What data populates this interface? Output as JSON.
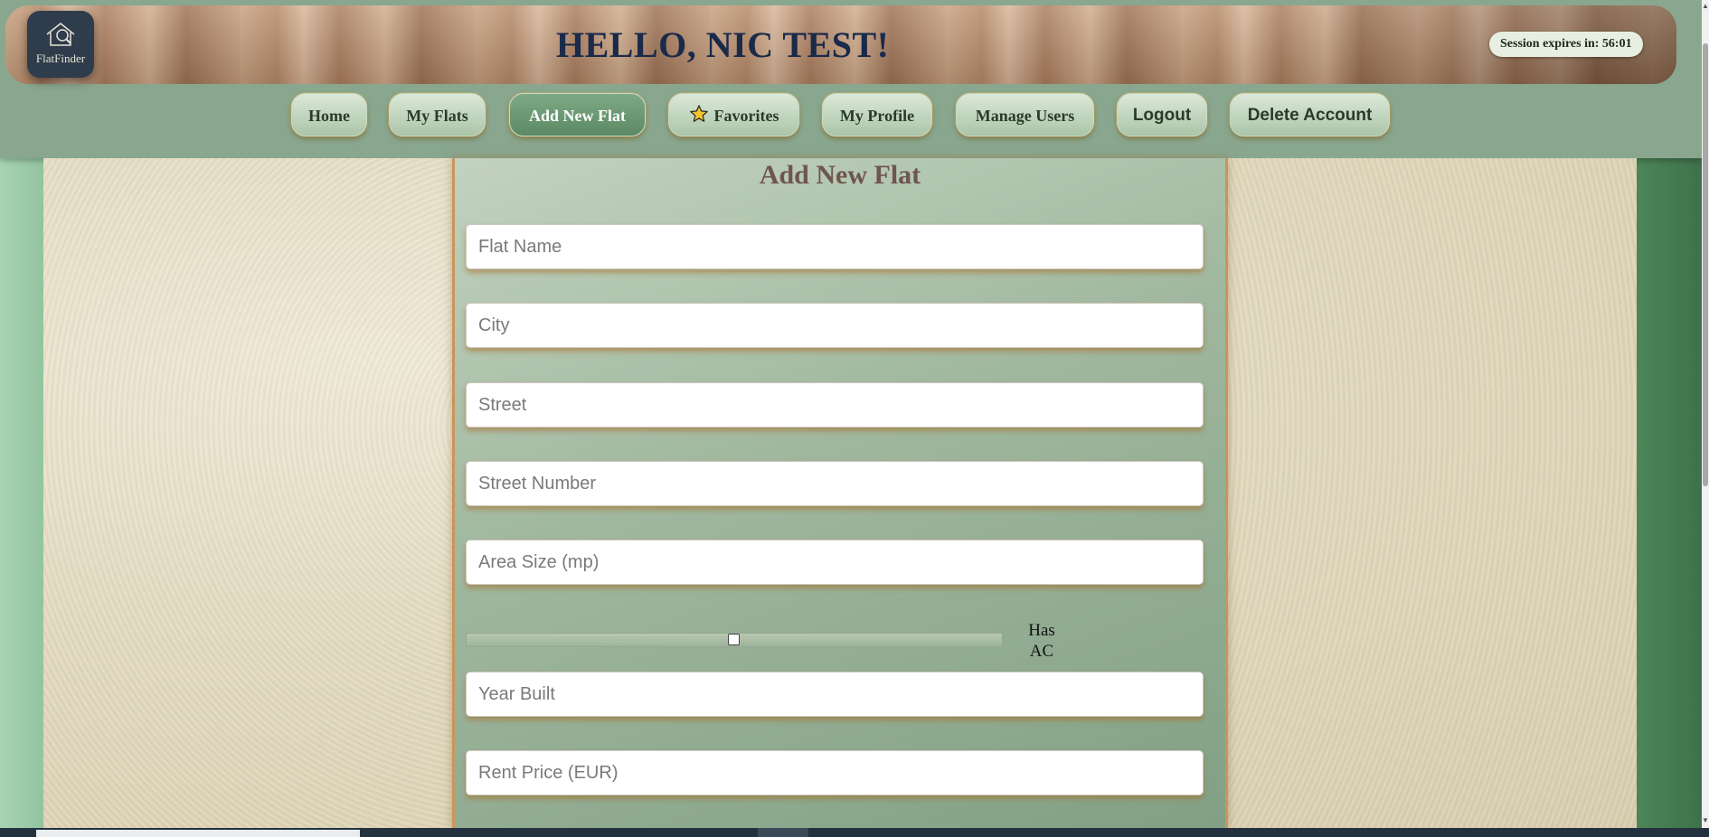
{
  "header": {
    "logo_text": "FlatFinder",
    "greeting": "HELLO, NIC TEST!",
    "session": "Session expires in: 56:01"
  },
  "nav": {
    "home": "Home",
    "my_flats": "My Flats",
    "add_new_flat": "Add New Flat",
    "favorites": "Favorites",
    "my_profile": "My Profile",
    "manage_users": "Manage Users",
    "logout": "Logout",
    "delete_account": "Delete Account",
    "active": "Add New Flat"
  },
  "form": {
    "title": "Add New Flat",
    "flat_name_placeholder": "Flat Name",
    "city_placeholder": "City",
    "street_placeholder": "Street",
    "street_number_placeholder": "Street Number",
    "area_size_placeholder": "Area Size (mp)",
    "has_ac_label": "Has AC",
    "has_ac_checked": false,
    "year_built_placeholder": "Year Built",
    "rent_price_placeholder": "Rent Price (EUR)"
  },
  "colors": {
    "active_nav": "#5b8a64",
    "greeting": "#1a2a4a",
    "title": "#6f554e"
  },
  "icons": {
    "logo": "house-magnifier-icon",
    "favorites": "star-icon"
  }
}
